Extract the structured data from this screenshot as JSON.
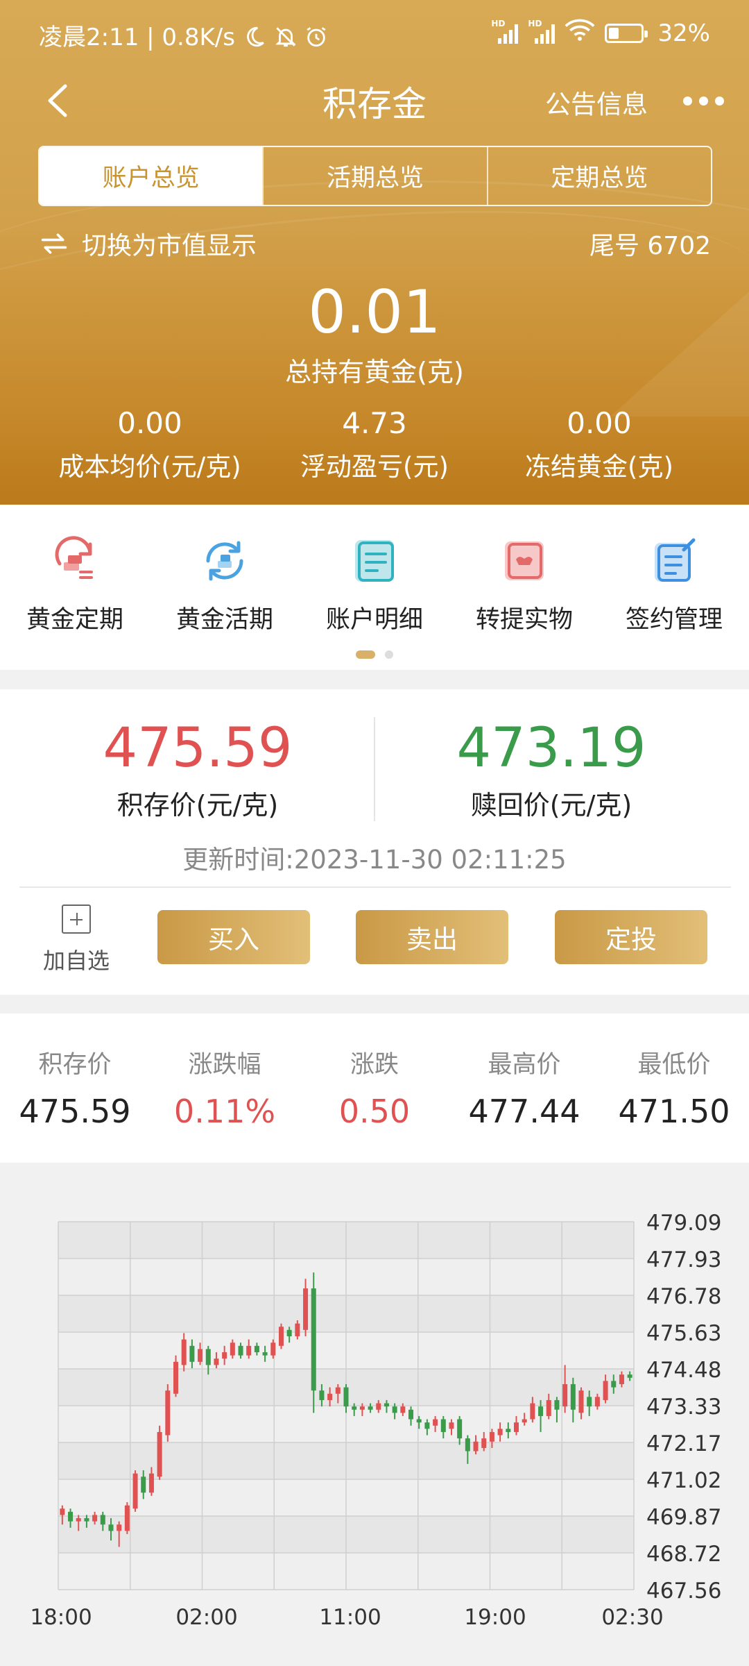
{
  "status_bar": {
    "left_text": "凌晨2:11 | 0.8K/s",
    "battery": "32%",
    "icons": [
      "moon-icon",
      "bell-off-icon",
      "alarm-icon",
      "signal-hd-icon",
      "signal-hd-icon",
      "wifi-icon",
      "battery-icon"
    ]
  },
  "nav": {
    "title": "积存金",
    "notice": "公告信息",
    "back_icon": "chevron-left-icon",
    "more_icon": "more-dots-icon"
  },
  "tabs": [
    {
      "label": "账户总览",
      "active": true
    },
    {
      "label": "活期总览",
      "active": false
    },
    {
      "label": "定期总览",
      "active": false
    }
  ],
  "account": {
    "switch_label": "切换为市值显示",
    "tail_no": "尾号 6702",
    "total_gold_value": "0.01",
    "total_gold_label": "总持有黄金(克)",
    "stats": [
      {
        "value": "0.00",
        "label": "成本均价(元/克)"
      },
      {
        "value": "4.73",
        "label": "浮动盈亏(元)"
      },
      {
        "value": "0.00",
        "label": "冻结黄金(克)"
      }
    ]
  },
  "quick_menu": [
    {
      "label": "黄金定期",
      "icon": "gold-fixed-icon"
    },
    {
      "label": "黄金活期",
      "icon": "gold-current-icon"
    },
    {
      "label": "账户明细",
      "icon": "account-detail-icon"
    },
    {
      "label": "转提实物",
      "icon": "physical-gold-icon"
    },
    {
      "label": "签约管理",
      "icon": "contract-manage-icon"
    }
  ],
  "prices": {
    "buy_value": "475.59",
    "buy_label": "积存价(元/克)",
    "sell_value": "473.19",
    "sell_label": "赎回价(元/克)",
    "update_time": "更新时间:2023-11-30 02:11:25"
  },
  "actions": {
    "add_fav": "加自选",
    "buy": "买入",
    "sell": "卖出",
    "plan": "定投"
  },
  "colors": {
    "up": "#e05252",
    "down": "#3a9b4a",
    "gold": "#c9932e"
  },
  "market_stats": [
    {
      "label": "积存价",
      "value": "475.59",
      "tone": "neutral"
    },
    {
      "label": "涨跌幅",
      "value": "0.11%",
      "tone": "up"
    },
    {
      "label": "涨跌",
      "value": "0.50",
      "tone": "up"
    },
    {
      "label": "最高价",
      "value": "477.44",
      "tone": "neutral"
    },
    {
      "label": "最低价",
      "value": "471.50",
      "tone": "neutral"
    }
  ],
  "chart_data": {
    "type": "candlestick",
    "y_ticks": [
      "479.09",
      "477.93",
      "476.78",
      "475.63",
      "474.48",
      "473.33",
      "472.17",
      "471.02",
      "469.87",
      "468.72",
      "467.56"
    ],
    "ylim": [
      467.56,
      479.09
    ],
    "x_ticks": [
      "18:00",
      "02:00",
      "11:00",
      "19:00",
      "02:30"
    ],
    "grid": true,
    "candles": [
      {
        "o": 469.9,
        "c": 470.1,
        "h": 470.2,
        "l": 469.6
      },
      {
        "o": 470.0,
        "c": 469.7,
        "h": 470.1,
        "l": 469.5
      },
      {
        "o": 469.7,
        "c": 469.8,
        "h": 469.9,
        "l": 469.4
      },
      {
        "o": 469.8,
        "c": 469.7,
        "h": 469.9,
        "l": 469.5
      },
      {
        "o": 469.7,
        "c": 469.9,
        "h": 470.0,
        "l": 469.6
      },
      {
        "o": 469.9,
        "c": 469.6,
        "h": 470.0,
        "l": 469.4
      },
      {
        "o": 469.6,
        "c": 469.4,
        "h": 469.8,
        "l": 469.1
      },
      {
        "o": 469.4,
        "c": 469.6,
        "h": 469.7,
        "l": 468.9
      },
      {
        "o": 469.4,
        "c": 470.2,
        "h": 470.3,
        "l": 469.3
      },
      {
        "o": 470.1,
        "c": 471.2,
        "h": 471.3,
        "l": 470.0
      },
      {
        "o": 471.1,
        "c": 470.6,
        "h": 471.3,
        "l": 470.4
      },
      {
        "o": 470.6,
        "c": 471.2,
        "h": 471.4,
        "l": 470.5
      },
      {
        "o": 471.1,
        "c": 472.5,
        "h": 472.7,
        "l": 471.0
      },
      {
        "o": 472.4,
        "c": 473.8,
        "h": 474.0,
        "l": 472.2
      },
      {
        "o": 473.7,
        "c": 474.7,
        "h": 474.9,
        "l": 473.6
      },
      {
        "o": 474.6,
        "c": 475.4,
        "h": 475.6,
        "l": 474.4
      },
      {
        "o": 475.2,
        "c": 474.7,
        "h": 475.4,
        "l": 474.5
      },
      {
        "o": 474.7,
        "c": 475.1,
        "h": 475.3,
        "l": 474.6
      },
      {
        "o": 475.1,
        "c": 474.6,
        "h": 475.2,
        "l": 474.3
      },
      {
        "o": 474.6,
        "c": 474.8,
        "h": 475.0,
        "l": 474.5
      },
      {
        "o": 474.8,
        "c": 475.0,
        "h": 475.2,
        "l": 474.6
      },
      {
        "o": 474.9,
        "c": 475.3,
        "h": 475.4,
        "l": 474.8
      },
      {
        "o": 475.2,
        "c": 474.9,
        "h": 475.3,
        "l": 474.8
      },
      {
        "o": 474.9,
        "c": 475.2,
        "h": 475.4,
        "l": 474.8
      },
      {
        "o": 475.2,
        "c": 475.0,
        "h": 475.3,
        "l": 474.9
      },
      {
        "o": 475.0,
        "c": 474.9,
        "h": 475.2,
        "l": 474.7
      },
      {
        "o": 474.9,
        "c": 475.3,
        "h": 475.4,
        "l": 474.8
      },
      {
        "o": 475.2,
        "c": 475.8,
        "h": 475.9,
        "l": 475.1
      },
      {
        "o": 475.7,
        "c": 475.5,
        "h": 475.8,
        "l": 475.3
      },
      {
        "o": 475.5,
        "c": 475.9,
        "h": 476.0,
        "l": 475.4
      },
      {
        "o": 475.7,
        "c": 477.0,
        "h": 477.3,
        "l": 475.5
      },
      {
        "o": 477.0,
        "c": 473.8,
        "h": 477.5,
        "l": 473.1
      },
      {
        "o": 473.8,
        "c": 473.5,
        "h": 474.0,
        "l": 473.3
      },
      {
        "o": 473.5,
        "c": 473.7,
        "h": 473.9,
        "l": 473.3
      },
      {
        "o": 473.7,
        "c": 473.9,
        "h": 474.0,
        "l": 473.4
      },
      {
        "o": 473.9,
        "c": 473.3,
        "h": 474.0,
        "l": 473.1
      },
      {
        "o": 473.3,
        "c": 473.2,
        "h": 473.4,
        "l": 473.0
      },
      {
        "o": 473.2,
        "c": 473.3,
        "h": 473.4,
        "l": 473.0
      },
      {
        "o": 473.3,
        "c": 473.2,
        "h": 473.4,
        "l": 473.1
      },
      {
        "o": 473.2,
        "c": 473.4,
        "h": 473.5,
        "l": 473.1
      },
      {
        "o": 473.4,
        "c": 473.3,
        "h": 473.5,
        "l": 473.1
      },
      {
        "o": 473.3,
        "c": 473.1,
        "h": 473.4,
        "l": 472.9
      },
      {
        "o": 473.1,
        "c": 473.3,
        "h": 473.4,
        "l": 473.0
      },
      {
        "o": 473.2,
        "c": 472.9,
        "h": 473.3,
        "l": 472.7
      },
      {
        "o": 472.9,
        "c": 472.8,
        "h": 473.0,
        "l": 472.6
      },
      {
        "o": 472.8,
        "c": 472.6,
        "h": 472.9,
        "l": 472.4
      },
      {
        "o": 472.7,
        "c": 472.9,
        "h": 473.0,
        "l": 472.5
      },
      {
        "o": 472.9,
        "c": 472.5,
        "h": 473.0,
        "l": 472.3
      },
      {
        "o": 472.6,
        "c": 472.8,
        "h": 472.9,
        "l": 472.4
      },
      {
        "o": 472.9,
        "c": 472.3,
        "h": 473.0,
        "l": 472.1
      },
      {
        "o": 472.3,
        "c": 471.9,
        "h": 472.4,
        "l": 471.5
      },
      {
        "o": 471.9,
        "c": 472.2,
        "h": 472.4,
        "l": 471.8
      },
      {
        "o": 472.0,
        "c": 472.3,
        "h": 472.5,
        "l": 471.9
      },
      {
        "o": 472.2,
        "c": 472.5,
        "h": 472.6,
        "l": 472.0
      },
      {
        "o": 472.4,
        "c": 472.6,
        "h": 472.8,
        "l": 472.2
      },
      {
        "o": 472.6,
        "c": 472.5,
        "h": 472.8,
        "l": 472.3
      },
      {
        "o": 472.5,
        "c": 472.8,
        "h": 473.0,
        "l": 472.4
      },
      {
        "o": 472.8,
        "c": 472.9,
        "h": 473.1,
        "l": 472.7
      },
      {
        "o": 472.9,
        "c": 473.4,
        "h": 473.6,
        "l": 472.8
      },
      {
        "o": 473.3,
        "c": 473.0,
        "h": 473.5,
        "l": 472.5
      },
      {
        "o": 473.0,
        "c": 473.5,
        "h": 473.7,
        "l": 472.9
      },
      {
        "o": 473.5,
        "c": 473.2,
        "h": 473.6,
        "l": 472.8
      },
      {
        "o": 473.3,
        "c": 474.0,
        "h": 474.6,
        "l": 473.1
      },
      {
        "o": 474.0,
        "c": 473.2,
        "h": 474.2,
        "l": 472.8
      },
      {
        "o": 473.1,
        "c": 473.8,
        "h": 473.9,
        "l": 472.9
      },
      {
        "o": 473.6,
        "c": 473.3,
        "h": 473.8,
        "l": 473.0
      },
      {
        "o": 473.3,
        "c": 473.6,
        "h": 473.7,
        "l": 473.2
      },
      {
        "o": 473.5,
        "c": 474.1,
        "h": 474.3,
        "l": 473.4
      },
      {
        "o": 474.1,
        "c": 473.9,
        "h": 474.3,
        "l": 473.7
      },
      {
        "o": 474.0,
        "c": 474.3,
        "h": 474.4,
        "l": 473.9
      },
      {
        "o": 474.3,
        "c": 474.2,
        "h": 474.4,
        "l": 474.1
      }
    ]
  }
}
